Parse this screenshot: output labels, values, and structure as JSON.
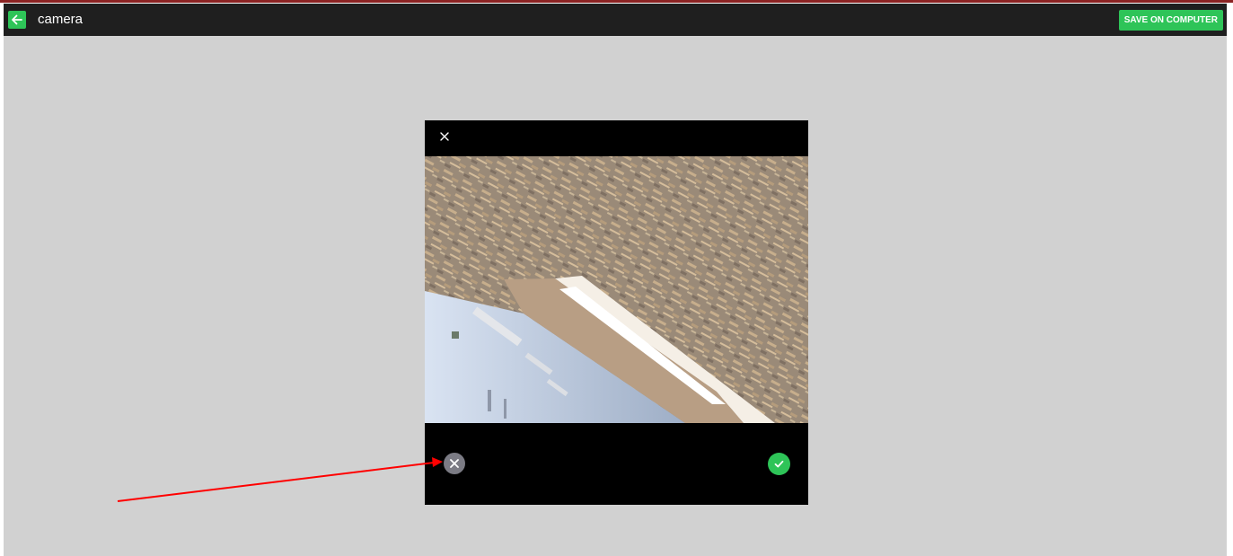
{
  "app_bar": {
    "title": "camera",
    "back_icon": "arrow-left-icon",
    "save_label": "SAVE ON COMPUTER"
  },
  "dialog": {
    "close_icon": "close-icon",
    "photo": "camera snapshot of a sloped OSB ceiling with skylight",
    "retake_icon": "close-circle-icon",
    "confirm_icon": "check-circle-icon"
  },
  "colors": {
    "accent_green": "#2ec458",
    "app_bar": "#1f1f1f",
    "background": "#d1d1d1",
    "annotation_arrow": "#ff0000",
    "top_accent": "#8b2323"
  }
}
